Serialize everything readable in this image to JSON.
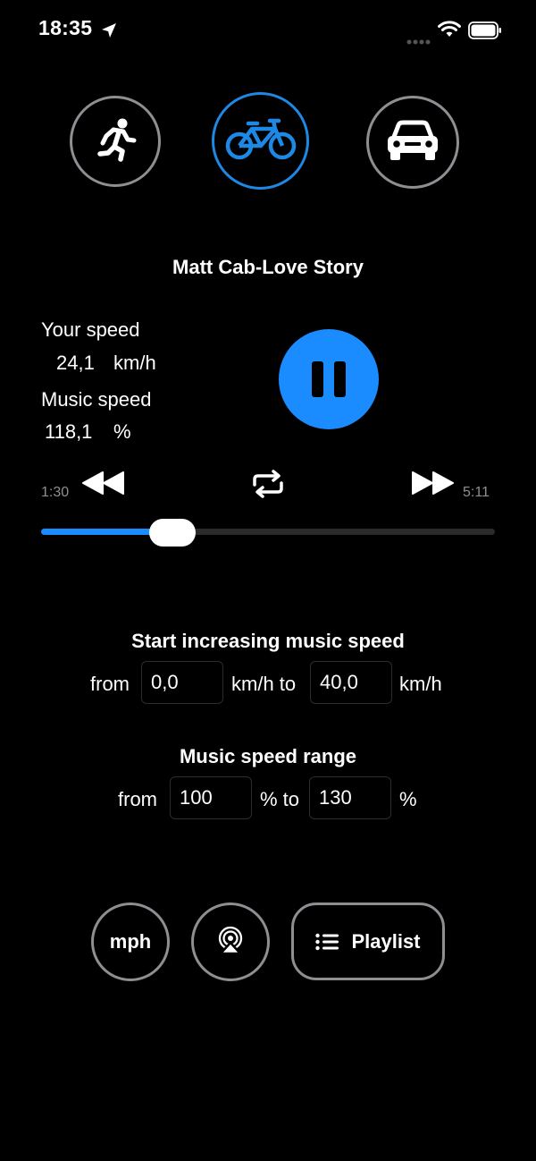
{
  "status_bar": {
    "time": "18:35"
  },
  "modes": [
    {
      "name": "walk",
      "icon": "running-person-icon",
      "selected": false
    },
    {
      "name": "bike",
      "icon": "bicycle-icon",
      "selected": true
    },
    {
      "name": "car",
      "icon": "car-icon",
      "selected": false
    }
  ],
  "player": {
    "song_title": "Matt Cab-Love Story",
    "your_speed_label": "Your speed",
    "your_speed_value": "24,1",
    "your_speed_unit": "km/h",
    "music_speed_label": "Music speed",
    "music_speed_value": "118,1",
    "music_speed_unit": "%",
    "time_elapsed": "1:30",
    "time_total": "5:11",
    "progress_fraction": 0.29
  },
  "speed_trigger": {
    "title": "Start increasing music speed",
    "from_label": "from",
    "from_value": "0,0",
    "mid_label": "km/h to",
    "to_value": "40,0",
    "unit_label": "km/h"
  },
  "speed_range": {
    "title": "Music speed range",
    "from_label": "from",
    "from_value": "100",
    "mid_label": "% to",
    "to_value": "130",
    "unit_label": "%"
  },
  "bottom_bar": {
    "mph_label": "mph",
    "playlist_label": "Playlist"
  },
  "colors": {
    "accent": "#1a8cff",
    "ring_inactive": "#8e8e93",
    "background": "#000000"
  }
}
